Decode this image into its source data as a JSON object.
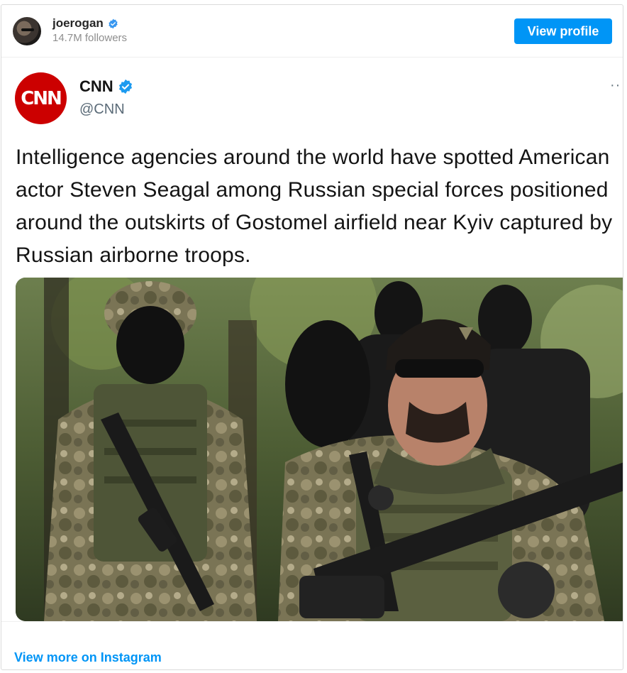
{
  "header": {
    "username": "joerogan",
    "followers": "14.7M followers",
    "view_profile_label": "View profile"
  },
  "tweet": {
    "logo_text": "CNN",
    "name": "CNN",
    "handle": "@CNN",
    "more": "··",
    "text": "Intelligence agencies around the world have spotted American actor Steven Seagal among Russian special forces positioned around the outskirts of Gostomel airfield near Kyiv captured by Russian airborne troops."
  },
  "footer": {
    "view_more_label": "View more on Instagram"
  },
  "colors": {
    "accent": "#0095f6",
    "cnn_red": "#cc0000",
    "verified": "#3897f0"
  },
  "icons": {
    "verified": "verified-badge-icon",
    "more": "more-options-icon"
  }
}
